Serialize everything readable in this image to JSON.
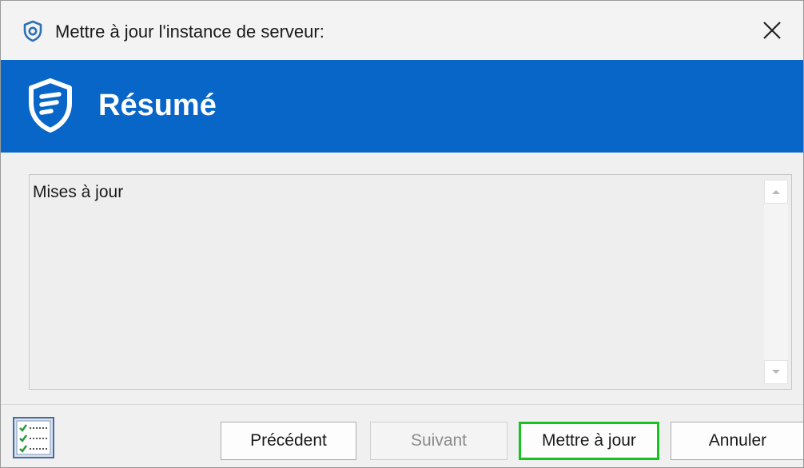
{
  "window": {
    "title": "Mettre à jour l'instance de serveur:",
    "accent_color": "#0766c8",
    "title_icon": "shield-icon",
    "close_icon": "close-icon"
  },
  "banner": {
    "title": "Résumé",
    "icon": "shield-icon"
  },
  "summary": {
    "text": "Mises à jour"
  },
  "footer": {
    "log_icon": "checklist-icon",
    "buttons": {
      "previous": "Précédent",
      "next": "Suivant",
      "update": "Mettre à jour",
      "cancel": "Annuler"
    },
    "next_disabled": true,
    "update_highlight_color": "#15c41f"
  }
}
